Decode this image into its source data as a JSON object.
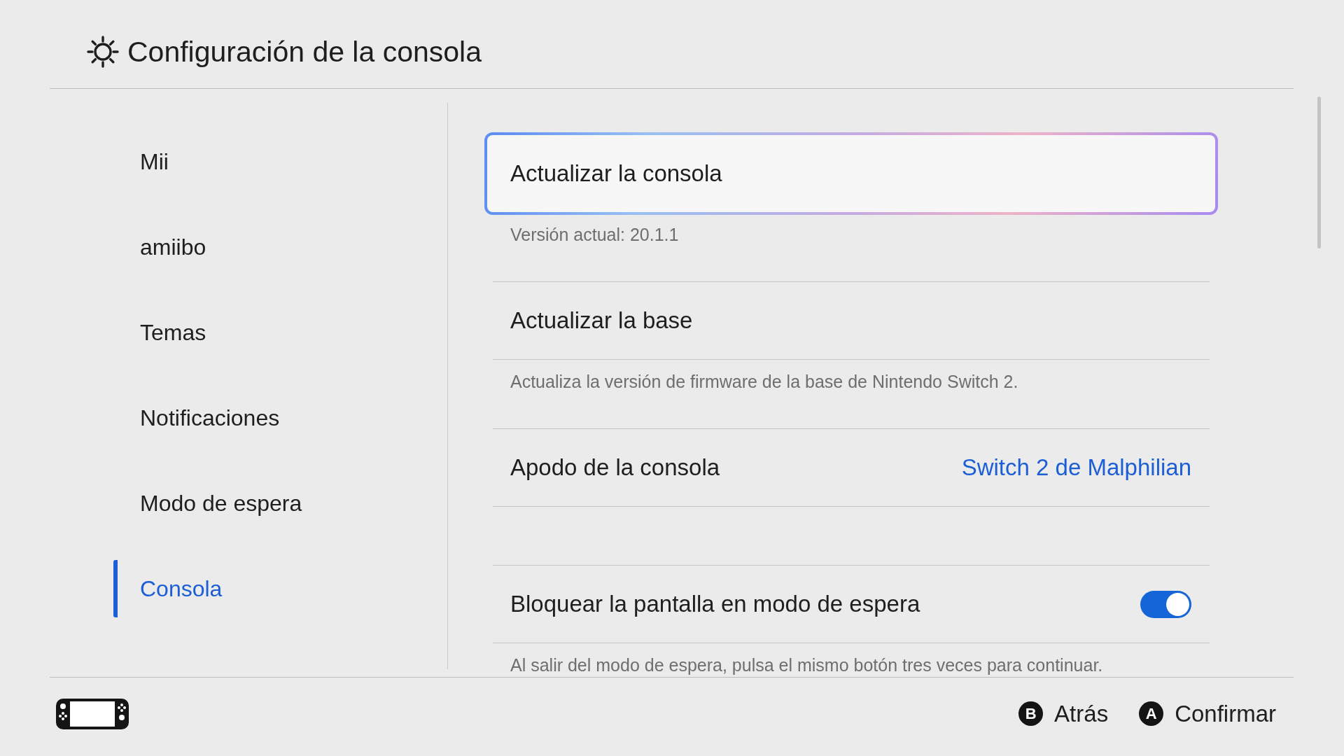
{
  "header": {
    "title": "Configuración de la consola"
  },
  "sidebar": {
    "items": [
      {
        "label": "Mii",
        "selected": false
      },
      {
        "label": "amiibo",
        "selected": false
      },
      {
        "label": "Temas",
        "selected": false
      },
      {
        "label": "Notificaciones",
        "selected": false
      },
      {
        "label": "Modo de espera",
        "selected": false
      },
      {
        "label": "Consola",
        "selected": true
      }
    ]
  },
  "settings": {
    "groups": [
      {
        "items": [
          {
            "kind": "action",
            "label": "Actualizar la consola",
            "selected": true,
            "description": "Versión actual: 20.1.1"
          },
          {
            "kind": "action",
            "label": "Actualizar la base",
            "selected": false,
            "description": "Actualiza la versión de firmware de la base de Nintendo Switch 2."
          },
          {
            "kind": "value",
            "label": "Apodo de la consola",
            "selected": false,
            "value": "Switch 2 de Malphilian"
          }
        ]
      },
      {
        "items": [
          {
            "kind": "toggle",
            "label": "Bloquear la pantalla en modo de espera",
            "selected": false,
            "on": true,
            "description": "Al salir del modo de espera, pulsa el mismo botón tres veces para continuar."
          }
        ]
      }
    ]
  },
  "footer": {
    "buttons": [
      {
        "key": "B",
        "label": "Atrás"
      },
      {
        "key": "A",
        "label": "Confirmar"
      }
    ]
  }
}
